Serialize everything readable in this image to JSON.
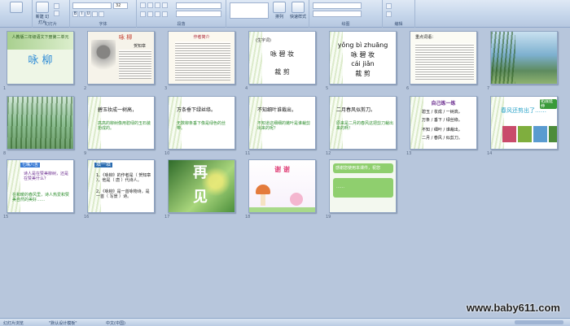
{
  "ribbon": {
    "clipboard_label": "",
    "slides_new_label": "新建\n幻灯片",
    "slides_label": "幻灯片",
    "font_label": "字体",
    "font_size": "32",
    "paragraph_label": "段落",
    "arrange_label": "排列",
    "quick_styles_label": "快速样式",
    "drawing_label": "绘图",
    "edit_label": "编辑"
  },
  "slides": {
    "s1": {
      "num": "1",
      "title": "人教版二年级语文下册第二单元",
      "heading": "咏  柳"
    },
    "s2": {
      "num": "2",
      "heading": "咏  柳",
      "author": "贺知章"
    },
    "s3": {
      "num": "3",
      "heading": "作者简介"
    },
    "s4": {
      "num": "4",
      "label": "(生字词)",
      "w1": "咏  碧  妆",
      "w2": "裁  剪"
    },
    "s5": {
      "num": "5",
      "p1": "yǒng  bì  zhuāng",
      "w1": "咏  碧  妆",
      "p2": "cái  jiǎn",
      "w2": "裁  剪"
    },
    "s6": {
      "num": "6",
      "heading": "重点词语："
    },
    "s7": {
      "num": "7"
    },
    "s8": {
      "num": "8"
    },
    "s9": {
      "num": "9",
      "line1": "碧玉妆成一树高，",
      "line2": "高高的柳树像用碧绿的玉石装扮成的。"
    },
    "s10": {
      "num": "10",
      "line1": "万条垂下绿丝绦。",
      "line2": "无数柳条垂下像是绿色的丝带。"
    },
    "s11": {
      "num": "11",
      "line1": "不知细叶谁裁出，",
      "line2": "不知道这细细的嫩叶是谁裁剪出来的呢？"
    },
    "s12": {
      "num": "12",
      "line1": "二月春风似剪刀。",
      "line2": "原来是二月的春风这把剪刀裁出来的啊！"
    },
    "s13": {
      "num": "13",
      "heading": "自己练一练",
      "l1": "碧玉 / 妆成 / 一树高，",
      "l2": "万条 / 垂下 / 绿丝绦。",
      "l3": "不知 / 细叶 / 谁裁出，",
      "l4": "二月 / 春风 / 似剪刀。"
    },
    "s14": {
      "num": "14",
      "badge": "拓展延伸",
      "heading": "春风还剪出了……"
    },
    "s15": {
      "num": "15",
      "heading": "七嘴八舌",
      "line1": "诗人是在赞美柳树，还是在赞美什么？",
      "line2": "在和暖的春风里，诗人热爱和赞美自然的美好……"
    },
    "s16": {
      "num": "16",
      "heading": "填一填",
      "l1": "1、《咏柳》的作者是（ 贺知章 ），他是（ 唐 ）代诗人。",
      "l2": "2、《咏柳》是一首咏物诗，是一首（ 写景 ）诗。"
    },
    "s17": {
      "num": "17",
      "c1": "再",
      "c2": "见"
    },
    "s18": {
      "num": "18",
      "heading": "谢  谢"
    },
    "s19": {
      "num": "19",
      "title": "感谢您使用本课件，祝您",
      "body": "……"
    }
  },
  "statusbar": {
    "left": "幻灯片浏览",
    "theme": "\"默认设计模板\"",
    "lang": "中文(中国)"
  },
  "watermark": "www.baby611.com"
}
